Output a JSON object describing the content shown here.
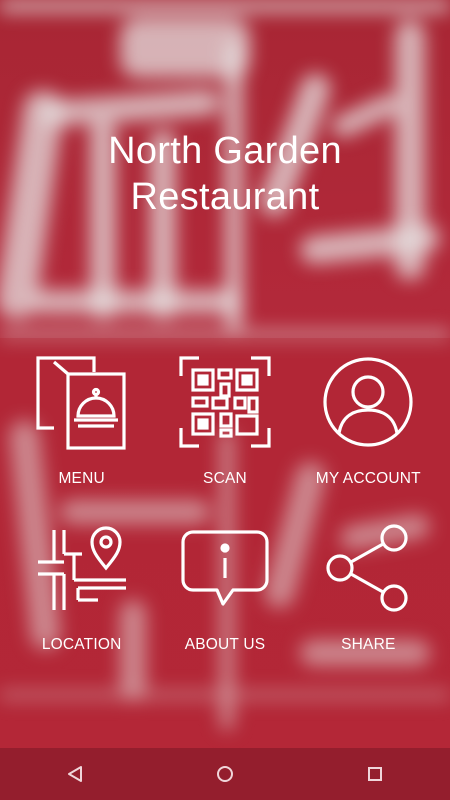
{
  "app": {
    "title_line1": "North Garden",
    "title_line2": "Restaurant"
  },
  "tiles": [
    {
      "label": "MENU",
      "icon": "menu-cloche-icon"
    },
    {
      "label": "SCAN",
      "icon": "qr-code-icon"
    },
    {
      "label": "MY ACCOUNT",
      "icon": "user-account-icon"
    },
    {
      "label": "LOCATION",
      "icon": "map-pin-icon"
    },
    {
      "label": "ABOUT US",
      "icon": "info-bubble-icon"
    },
    {
      "label": "SHARE",
      "icon": "share-icon"
    }
  ],
  "navbar": {
    "back": "back-icon",
    "home": "home-icon",
    "recents": "recents-icon"
  },
  "colors": {
    "background": "#b02a38",
    "foreground": "#ffffff"
  }
}
